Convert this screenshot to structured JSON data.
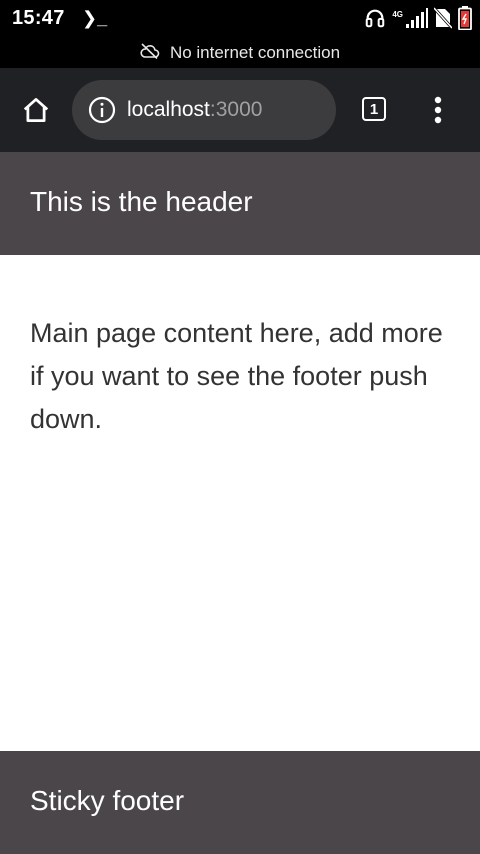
{
  "status_bar": {
    "time": "15:47",
    "terminal_glyph": "❯_",
    "network_type": "4G",
    "icons": [
      "headphones-icon",
      "signal-icon",
      "no-sim-icon",
      "battery-icon"
    ]
  },
  "banner": {
    "text": "No internet connection",
    "icon": "cloud-off-icon"
  },
  "browser": {
    "url_host": "localhost",
    "url_port": ":3000",
    "tab_count": "1",
    "icons": [
      "home-icon",
      "info-icon",
      "tab-switcher-icon",
      "more-vert-icon"
    ]
  },
  "page": {
    "header": "This is the header",
    "content": "Main page content here, add more if you want to see the footer push down.",
    "footer": "Sticky footer"
  },
  "colors": {
    "status_bar": "#000000",
    "toolbar": "#202124",
    "omnibox": "#3c3c3e",
    "header_footer_bg": "#4a4649",
    "content_text": "#333333",
    "battery_fill": "#e53935"
  }
}
